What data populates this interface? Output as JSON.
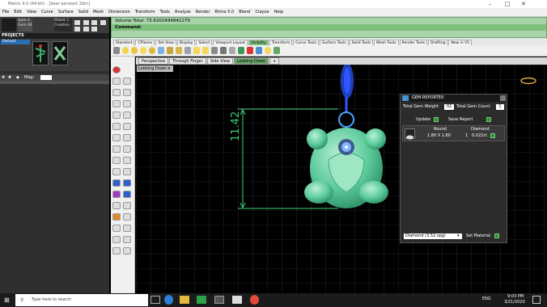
{
  "window": {
    "title": "Matrix 9.0 (64-bit) - [bear pendant.3dm]"
  },
  "menubar": [
    "File",
    "Edit",
    "View",
    "Curve",
    "Surface",
    "Solid",
    "Mesh",
    "Dimension",
    "Transform",
    "Tools",
    "Analyze",
    "Render",
    "Rhino 5.0",
    "Blend",
    "Clayoo",
    "Help"
  ],
  "left_panel": {
    "top_labels": [
      "Gem 1",
      "Gem 04"
    ],
    "top_labels2": [
      "Shank 1",
      "Creation"
    ],
    "projects_label": "PROJECTS",
    "default_label": "Default",
    "mag_label": "Mag:"
  },
  "command": {
    "history": "Volume Total: 73.6202494841279",
    "prompt": "Command:"
  },
  "toolbar_tabs": [
    "Standard",
    "CPlanes",
    "Set View",
    "Display",
    "Select",
    "Viewport Layout",
    "Visibility",
    "Transform",
    "Curve Tools",
    "Surface Tools",
    "Solid Tools",
    "Mesh Tools",
    "Render Tools",
    "Drafting",
    "New in V5"
  ],
  "toolbar_active_tab": "Visibility",
  "viewport_tabs": [
    "Perspective",
    "Through Finger",
    "Side View",
    "Looking Down"
  ],
  "viewport_active": "Looking Down",
  "viewport_label": "Looking Down",
  "dimension_text": "11.42",
  "gem_reporter": {
    "title": "GEM REPORTER",
    "total_weight_label": "Total Gem Weight",
    "total_weight_value": "02",
    "total_count_label": "Total Gem Count",
    "total_count_value": "1",
    "update_label": "Update",
    "save_label": "Save Report",
    "shape": "Round",
    "size": "1.80 X 1.80",
    "material_header": "Diamond",
    "count": "1",
    "weight": "0.022ct",
    "material_select": "Diamond (3.52 spg)",
    "set_material_label": "Set Material"
  },
  "taskbar": {
    "search_placeholder": "Type here to search",
    "lang": "ENG",
    "time": "9:03 PM",
    "date": "3/21/2020"
  }
}
